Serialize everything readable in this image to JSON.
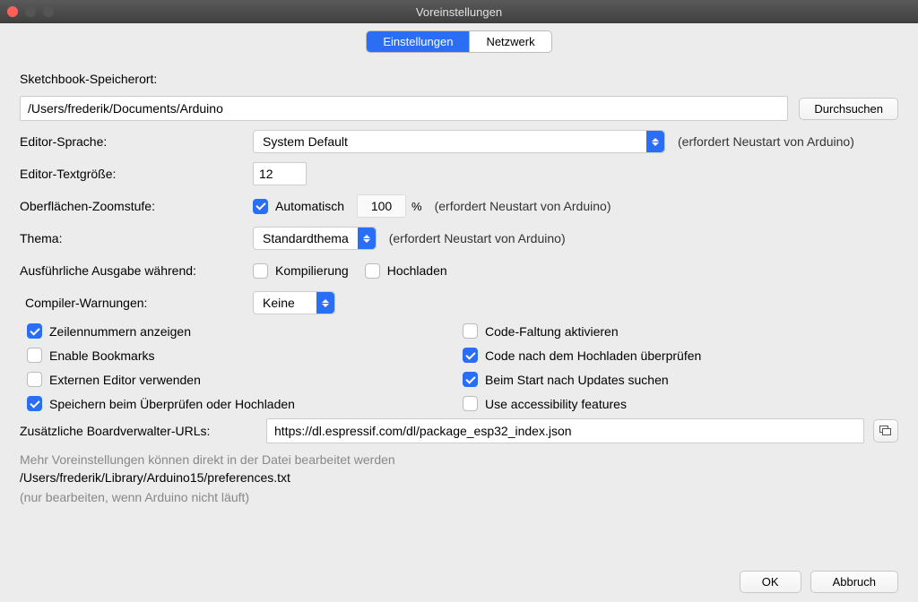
{
  "window": {
    "title": "Voreinstellungen"
  },
  "tabs": {
    "settings": "Einstellungen",
    "network": "Netzwerk"
  },
  "sketchbook": {
    "label": "Sketchbook-Speicherort:",
    "path": "/Users/frederik/Documents/Arduino",
    "browse": "Durchsuchen"
  },
  "language": {
    "label": "Editor-Sprache:",
    "value": "System Default",
    "note": "(erfordert Neustart von Arduino)"
  },
  "fontsize": {
    "label": "Editor-Textgröße:",
    "value": "12"
  },
  "zoom": {
    "label": "Oberflächen-Zoomstufe:",
    "auto": "Automatisch",
    "value": "100",
    "pct": "%",
    "note": "(erfordert Neustart von Arduino)"
  },
  "theme": {
    "label": "Thema:",
    "value": "Standardthema",
    "note": "(erfordert Neustart von Arduino)"
  },
  "verbose": {
    "label": "Ausführliche Ausgabe während:",
    "compile": "Kompilierung",
    "upload": "Hochladen"
  },
  "warnings": {
    "label": "Compiler-Warnungen:",
    "value": "Keine"
  },
  "checks": {
    "linenumbers": "Zeilennummern anzeigen",
    "bookmarks": "Enable Bookmarks",
    "external": "Externen Editor verwenden",
    "saveverify": "Speichern beim Überprüfen oder Hochladen",
    "folding": "Code-Faltung aktivieren",
    "verifyupload": "Code nach dem Hochladen überprüfen",
    "updates": "Beim Start nach Updates suchen",
    "a11y": "Use accessibility features"
  },
  "boards": {
    "label": "Zusätzliche Boardverwalter-URLs:",
    "value": "https://dl.espressif.com/dl/package_esp32_index.json"
  },
  "more": {
    "hint": "Mehr Voreinstellungen können direkt in der Datei bearbeitet werden",
    "path": "/Users/frederik/Library/Arduino15/preferences.txt",
    "only": "(nur bearbeiten, wenn Arduino nicht läuft)"
  },
  "buttons": {
    "ok": "OK",
    "cancel": "Abbruch"
  }
}
